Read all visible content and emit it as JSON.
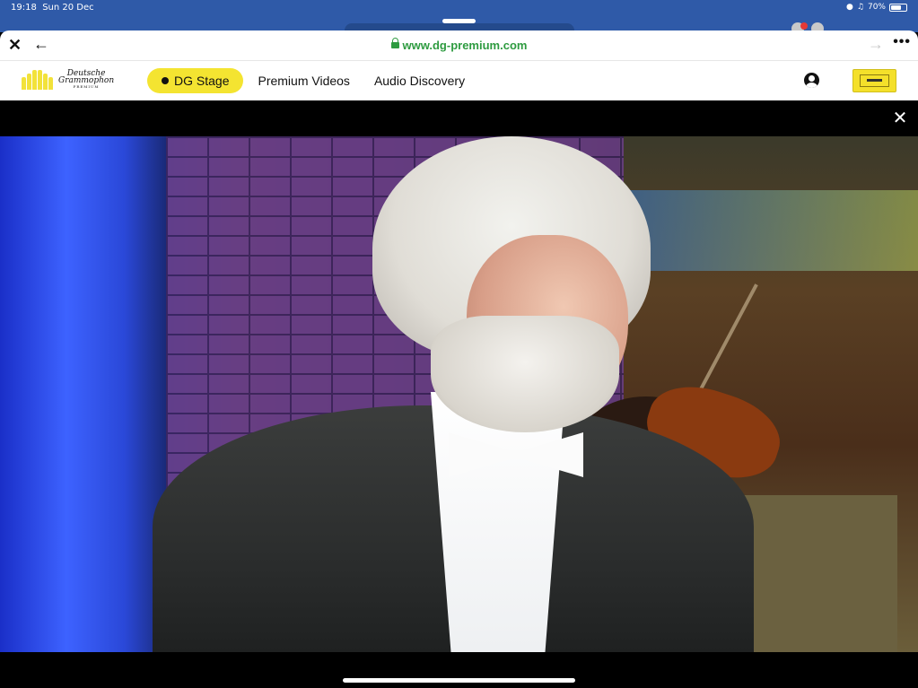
{
  "status_bar": {
    "time": "19:18",
    "date": "Sun 20 Dec",
    "battery_percent": "70%",
    "battery_level": 0.7
  },
  "browser": {
    "url": "www.dg-premium.com",
    "icons": {
      "close": "close-icon",
      "back": "arrow-left-icon",
      "forward": "arrow-right-icon",
      "more": "more-icon",
      "lock": "lock-icon"
    }
  },
  "site": {
    "logo": {
      "line1": "Deutsche",
      "line2": "Grammophon",
      "line3": "PREMIUM"
    },
    "nav": {
      "stage_label": "DG Stage",
      "videos_label": "Premium Videos",
      "audio_label": "Audio Discovery"
    },
    "icons": {
      "account": "account-icon",
      "badge": "dg-yellow-label-logo"
    },
    "colors": {
      "accent": "#f4e431",
      "url": "#2e9b40",
      "status_bar": "#2f5aa8"
    }
  },
  "player": {
    "icons": {
      "close": "close-icon"
    },
    "video_description_icon": "video-frame"
  }
}
